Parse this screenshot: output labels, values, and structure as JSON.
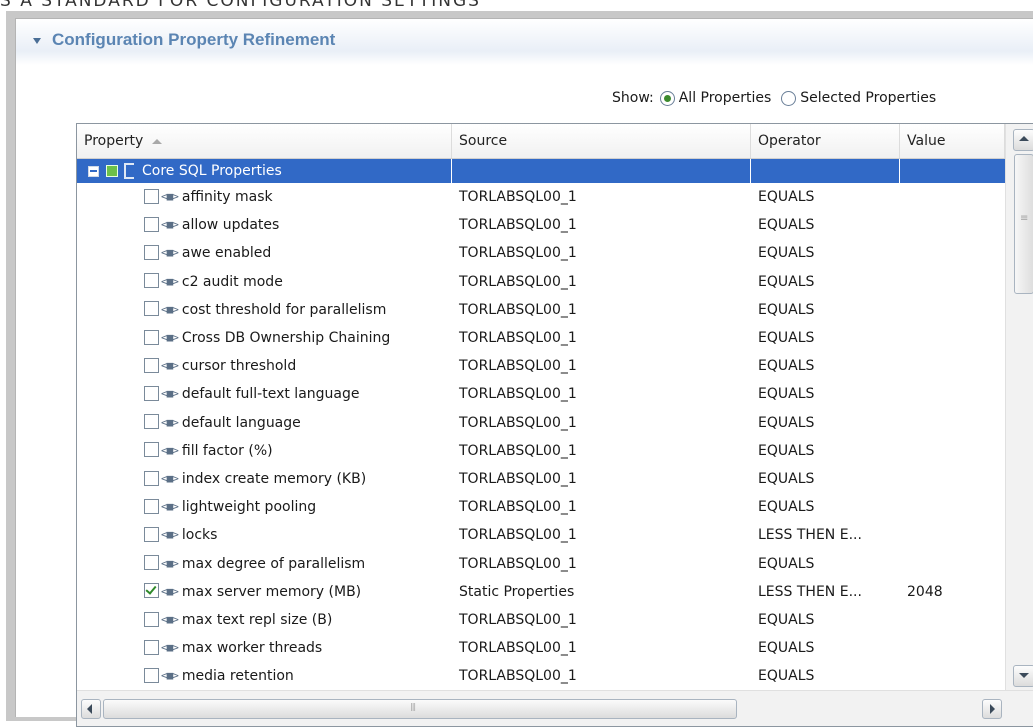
{
  "caption": "S A STANDARD FOR CONFIGURATION SETTINGS",
  "section": {
    "title": "Configuration Property Refinement"
  },
  "show": {
    "label": "Show:",
    "options": [
      {
        "label": "All Properties",
        "selected": true
      },
      {
        "label": "Selected Properties",
        "selected": false
      }
    ]
  },
  "table": {
    "columns": {
      "property": "Property",
      "source": "Source",
      "operator": "Operator",
      "value": "Value"
    },
    "group": {
      "label": "Core SQL Properties"
    },
    "rows": [
      {
        "property": "affinity mask",
        "source": "TORLABSQL00_1",
        "operator": "EQUALS",
        "value": "",
        "checked": false
      },
      {
        "property": "allow updates",
        "source": "TORLABSQL00_1",
        "operator": "EQUALS",
        "value": "",
        "checked": false
      },
      {
        "property": "awe enabled",
        "source": "TORLABSQL00_1",
        "operator": "EQUALS",
        "value": "",
        "checked": false
      },
      {
        "property": "c2 audit mode",
        "source": "TORLABSQL00_1",
        "operator": "EQUALS",
        "value": "",
        "checked": false
      },
      {
        "property": "cost threshold for parallelism",
        "source": "TORLABSQL00_1",
        "operator": "EQUALS",
        "value": "",
        "checked": false
      },
      {
        "property": "Cross DB Ownership Chaining",
        "source": "TORLABSQL00_1",
        "operator": "EQUALS",
        "value": "",
        "checked": false
      },
      {
        "property": "cursor threshold",
        "source": "TORLABSQL00_1",
        "operator": "EQUALS",
        "value": "",
        "checked": false
      },
      {
        "property": "default full-text language",
        "source": "TORLABSQL00_1",
        "operator": "EQUALS",
        "value": "",
        "checked": false
      },
      {
        "property": "default language",
        "source": "TORLABSQL00_1",
        "operator": "EQUALS",
        "value": "",
        "checked": false
      },
      {
        "property": "fill factor (%)",
        "source": "TORLABSQL00_1",
        "operator": "EQUALS",
        "value": "",
        "checked": false
      },
      {
        "property": "index create memory (KB)",
        "source": "TORLABSQL00_1",
        "operator": "EQUALS",
        "value": "",
        "checked": false
      },
      {
        "property": "lightweight pooling",
        "source": "TORLABSQL00_1",
        "operator": "EQUALS",
        "value": "",
        "checked": false
      },
      {
        "property": "locks",
        "source": "TORLABSQL00_1",
        "operator": "LESS THEN E...",
        "value": "",
        "checked": false
      },
      {
        "property": "max degree of parallelism",
        "source": "TORLABSQL00_1",
        "operator": "EQUALS",
        "value": "",
        "checked": false
      },
      {
        "property": "max server memory (MB)",
        "source": "Static Properties",
        "operator": "LESS THEN E...",
        "value": "2048",
        "checked": true
      },
      {
        "property": "max text repl size (B)",
        "source": "TORLABSQL00_1",
        "operator": "EQUALS",
        "value": "",
        "checked": false
      },
      {
        "property": "max worker threads",
        "source": "TORLABSQL00_1",
        "operator": "EQUALS",
        "value": "",
        "checked": false
      },
      {
        "property": "media retention",
        "source": "TORLABSQL00_1",
        "operator": "EQUALS",
        "value": "",
        "checked": false
      }
    ]
  },
  "colors": {
    "selection": "#3169c6",
    "section_title": "#5b85b3",
    "radio_on": "#3c8a2e"
  }
}
